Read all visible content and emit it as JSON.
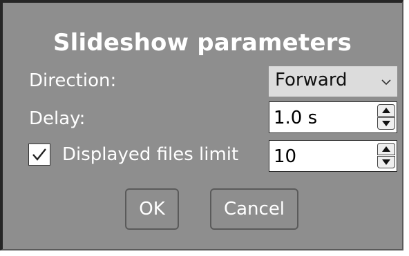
{
  "dialog": {
    "title": "Slideshow parameters",
    "direction": {
      "label": "Direction:",
      "value": "Forward",
      "icon": "chevron-down-icon"
    },
    "delay": {
      "label": "Delay:",
      "value": "1.0 s"
    },
    "files_limit": {
      "label": "Displayed files limit",
      "checked": true,
      "value": "10"
    },
    "buttons": {
      "ok": "OK",
      "cancel": "Cancel"
    }
  },
  "colors": {
    "dialog_bg": "#8e8e8e",
    "text": "#ffffff",
    "field_bg": "#ffffff",
    "combo_bg": "#dcdcdc"
  }
}
